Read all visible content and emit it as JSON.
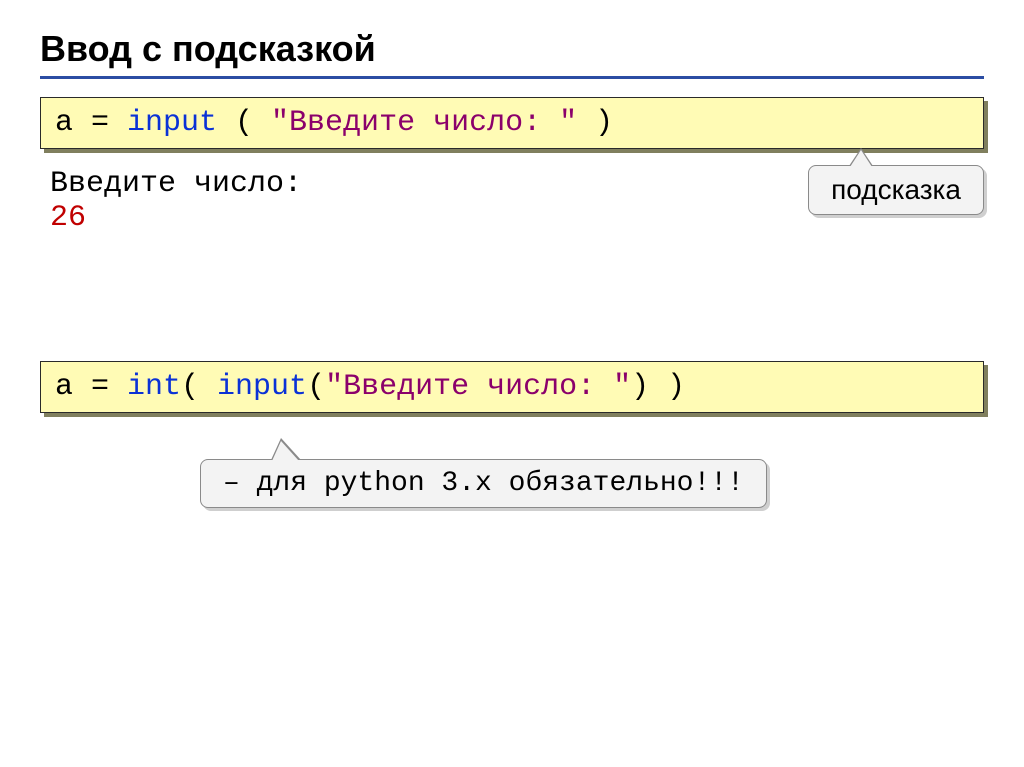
{
  "title": "Ввод с подсказкой",
  "code1": {
    "prefix": "a = ",
    "fn": "input",
    "paren_open": " ( ",
    "string": "\"Введите число: \"",
    "paren_close": " )"
  },
  "output": {
    "prompt": "Введите число: ",
    "value": "26"
  },
  "hint1": "подсказка",
  "code2": {
    "prefix": "a = ",
    "fn1": "int",
    "open1": "( ",
    "fn2": "input",
    "open2": "(",
    "string": "\"Введите число: \"",
    "close2": ")",
    "close1": " )"
  },
  "hint2": "– для python 3.x обязательно!!!"
}
